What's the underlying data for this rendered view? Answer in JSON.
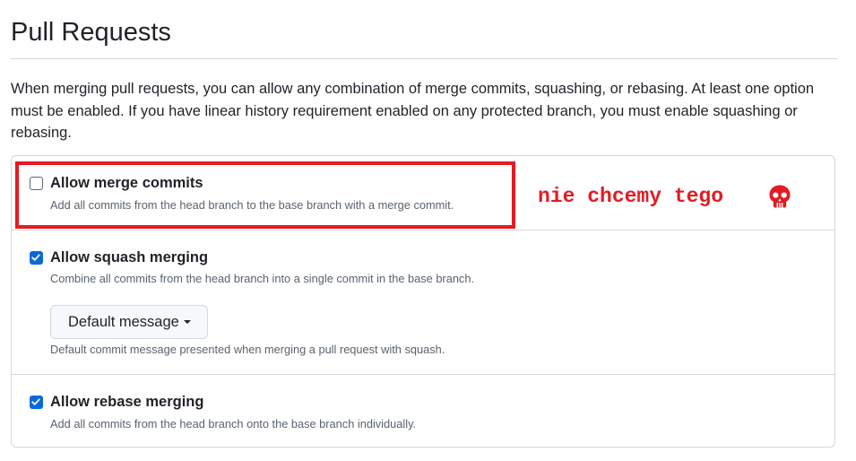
{
  "page": {
    "title": "Pull Requests",
    "description": "When merging pull requests, you can allow any combination of merge commits, squashing, or rebasing. At least one option must be enabled. If you have linear history requirement enabled on any protected branch, you must enable squashing or rebasing."
  },
  "options": [
    {
      "label": "Allow merge commits",
      "description": "Add all commits from the head branch to the base branch with a merge commit.",
      "checked": false
    },
    {
      "label": "Allow squash merging",
      "description": "Combine all commits from the head branch into a single commit in the base branch.",
      "checked": true,
      "dropdown": {
        "label": "Default message",
        "help": "Default commit message presented when merging a pull request with squash."
      }
    },
    {
      "label": "Allow rebase merging",
      "description": "Add all commits from the head branch onto the base branch individually.",
      "checked": true
    }
  ],
  "annotation": {
    "text": "nie chcemy tego",
    "icon": "skull-icon",
    "color": "#e31b23"
  },
  "colors": {
    "checkbox_checked": "#0969da",
    "border": "#d1d9e0",
    "muted_text": "#59636e"
  }
}
